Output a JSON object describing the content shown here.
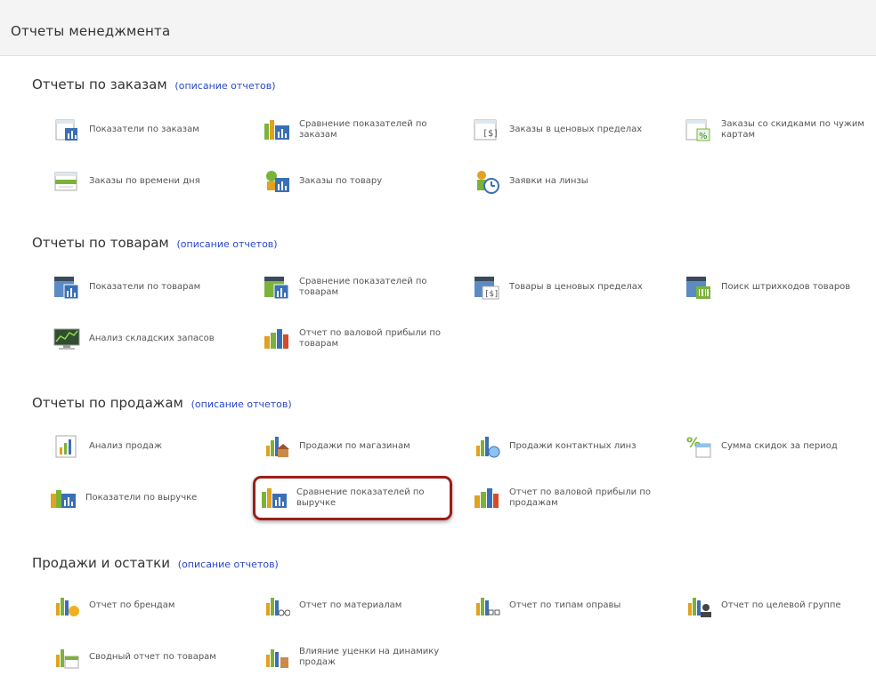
{
  "header": {
    "title": "Отчеты менеджмента"
  },
  "link_text": "(описание отчетов)",
  "sections": [
    {
      "title": "Отчеты по заказам",
      "reports": [
        "Показатели по заказам",
        "Сравнение показателей по заказам",
        "Заказы в ценовых пределах",
        "Заказы со скидками по чужим картам",
        "Заказы по времени дня",
        "Заказы по товару",
        "Заявки на линзы"
      ]
    },
    {
      "title": "Отчеты по товарам",
      "reports": [
        "Показатели по товарам",
        "Сравнение показателей по товарам",
        "Товары в ценовых пределах",
        "Поиск штрихкодов товаров",
        "Анализ складских запасов",
        "Отчет по валовой прибыли по товарам"
      ]
    },
    {
      "title": "Отчеты по продажам",
      "reports": [
        "Анализ продаж",
        "Продажи по магазинам",
        "Продажи контактных линз",
        "Сумма скидок за период",
        "Показатели по выручке",
        "Сравнение показателей по выручке",
        "Отчет по валовой прибыли по продажам"
      ]
    },
    {
      "title": "Продажи и остатки",
      "reports": [
        "Отчет по брендам",
        "Отчет по материалам",
        "Отчет по типам оправы",
        "Отчет по целевой группе",
        "Сводный отчет по товарам",
        "Влияние уценки на динамику продаж"
      ]
    }
  ],
  "colors": {
    "link": "#2a46c8",
    "highlight_border": "#9a1f1a",
    "icon_blue": "#3b6fb5",
    "icon_green": "#7bb33a",
    "icon_gold": "#e0a21f"
  }
}
